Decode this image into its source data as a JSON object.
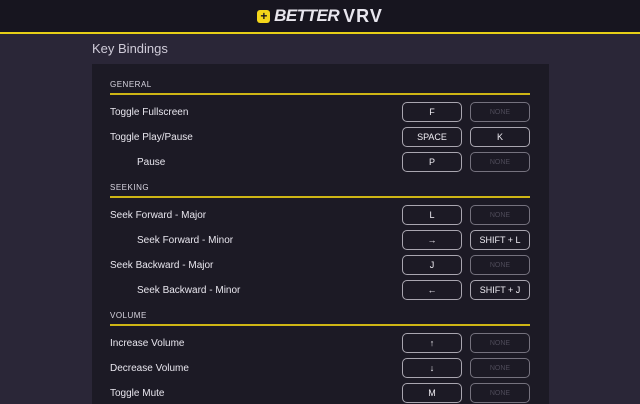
{
  "header": {
    "logo_better": "BETTER",
    "logo_vrv": "VRV"
  },
  "title": "Key Bindings",
  "sections": [
    {
      "name": "GENERAL",
      "rows": [
        {
          "label": "Toggle Fullscreen",
          "sub": false,
          "k1": "F",
          "k2": "NONE"
        },
        {
          "label": "Toggle Play/Pause",
          "sub": false,
          "k1": "SPACE",
          "k2": "K"
        },
        {
          "label": "Pause",
          "sub": true,
          "k1": "P",
          "k2": "NONE"
        }
      ]
    },
    {
      "name": "SEEKING",
      "rows": [
        {
          "label": "Seek Forward - Major",
          "sub": false,
          "k1": "L",
          "k2": "NONE"
        },
        {
          "label": "Seek Forward - Minor",
          "sub": true,
          "k1": "→",
          "k2": "SHIFT + L"
        },
        {
          "label": "Seek Backward - Major",
          "sub": false,
          "k1": "J",
          "k2": "NONE"
        },
        {
          "label": "Seek Backward - Minor",
          "sub": true,
          "k1": "←",
          "k2": "SHIFT + J"
        }
      ]
    },
    {
      "name": "VOLUME",
      "rows": [
        {
          "label": "Increase Volume",
          "sub": false,
          "k1": "↑",
          "k2": "NONE"
        },
        {
          "label": "Decrease Volume",
          "sub": false,
          "k1": "↓",
          "k2": "NONE"
        },
        {
          "label": "Toggle Mute",
          "sub": false,
          "k1": "M",
          "k2": "NONE"
        }
      ]
    }
  ]
}
